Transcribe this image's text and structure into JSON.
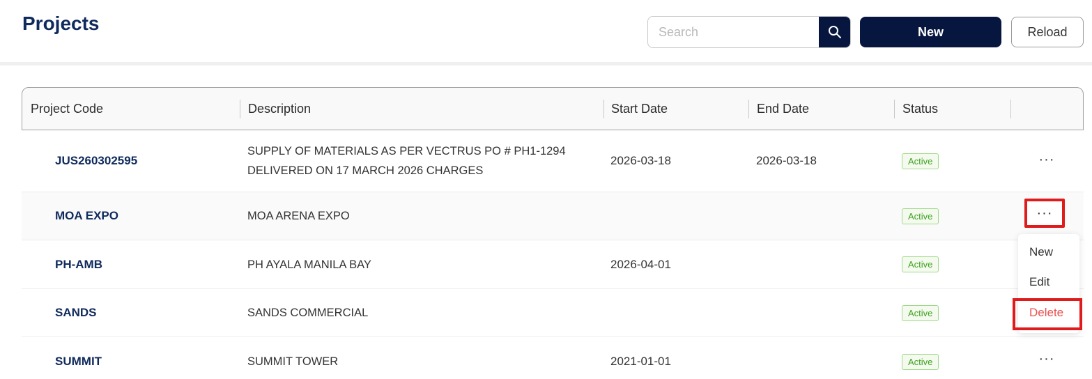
{
  "header": {
    "title": "Projects",
    "search_placeholder": "Search",
    "new_label": "New",
    "reload_label": "Reload"
  },
  "table": {
    "columns": [
      "Project Code",
      "Description",
      "Start Date",
      "End Date",
      "Status"
    ],
    "rows": [
      {
        "code": "JUS260302595",
        "description_line1": "SUPPLY OF MATERIALS AS PER VECTRUS PO # PH1-1294",
        "description_line2": "DELIVERED ON 17 MARCH 2026 CHARGES",
        "start_date": "2026-03-18",
        "end_date": "2026-03-18",
        "status": "Active",
        "actions": "···"
      },
      {
        "code": "MOA EXPO",
        "description_line1": "MOA ARENA EXPO",
        "start_date": "",
        "end_date": "",
        "status": "Active",
        "actions": "···"
      },
      {
        "code": "PH-AMB",
        "description_line1": "PH AYALA MANILA BAY",
        "start_date": "2026-04-01",
        "end_date": "",
        "status": "Active",
        "actions": ""
      },
      {
        "code": "SANDS",
        "description_line1": "SANDS COMMERCIAL",
        "start_date": "",
        "end_date": "",
        "status": "Active",
        "actions": ""
      },
      {
        "code": "SUMMIT",
        "description_line1": "SUMMIT TOWER",
        "start_date": "2021-01-01",
        "end_date": "",
        "status": "Active",
        "actions": "···"
      }
    ]
  },
  "context_menu": {
    "items": [
      "New",
      "Edit",
      "Delete"
    ]
  },
  "icons": {
    "search": "search-icon",
    "more": "more-dots-icon"
  },
  "colors": {
    "primary": "#07163f",
    "title": "#0f2a5c",
    "status_active": "#41a223",
    "delete": "#e8504f",
    "highlight": "#e01b1b"
  }
}
